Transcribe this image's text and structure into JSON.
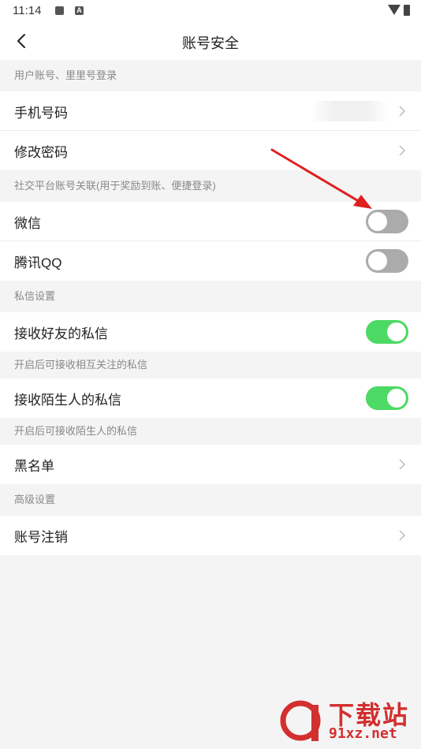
{
  "status_bar": {
    "time": "11:14",
    "badge_letter": "A"
  },
  "header": {
    "title": "账号安全"
  },
  "sections": {
    "login": {
      "header": "用户账号、里里号登录",
      "phone_label": "手机号码",
      "password_label": "修改密码"
    },
    "social": {
      "header": "社交平台账号关联(用于奖励到账、便捷登录)",
      "wechat_label": "微信",
      "wechat_enabled": false,
      "qq_label": "腾讯QQ",
      "qq_enabled": false
    },
    "messages": {
      "header": "私信设置",
      "friends_label": "接收好友的私信",
      "friends_enabled": true,
      "friends_hint": "开启后可接收相互关注的私信",
      "strangers_label": "接收陌生人的私信",
      "strangers_enabled": true,
      "strangers_hint": "开启后可接收陌生人的私信",
      "blacklist_label": "黑名单"
    },
    "advanced": {
      "header": "高级设置",
      "cancel_account_label": "账号注销"
    }
  },
  "watermark": {
    "big": "下载站",
    "small": "91xz.net"
  },
  "colors": {
    "toggle_on": "#4cd964",
    "toggle_off": "#ababab",
    "annotation": "#e02020"
  }
}
